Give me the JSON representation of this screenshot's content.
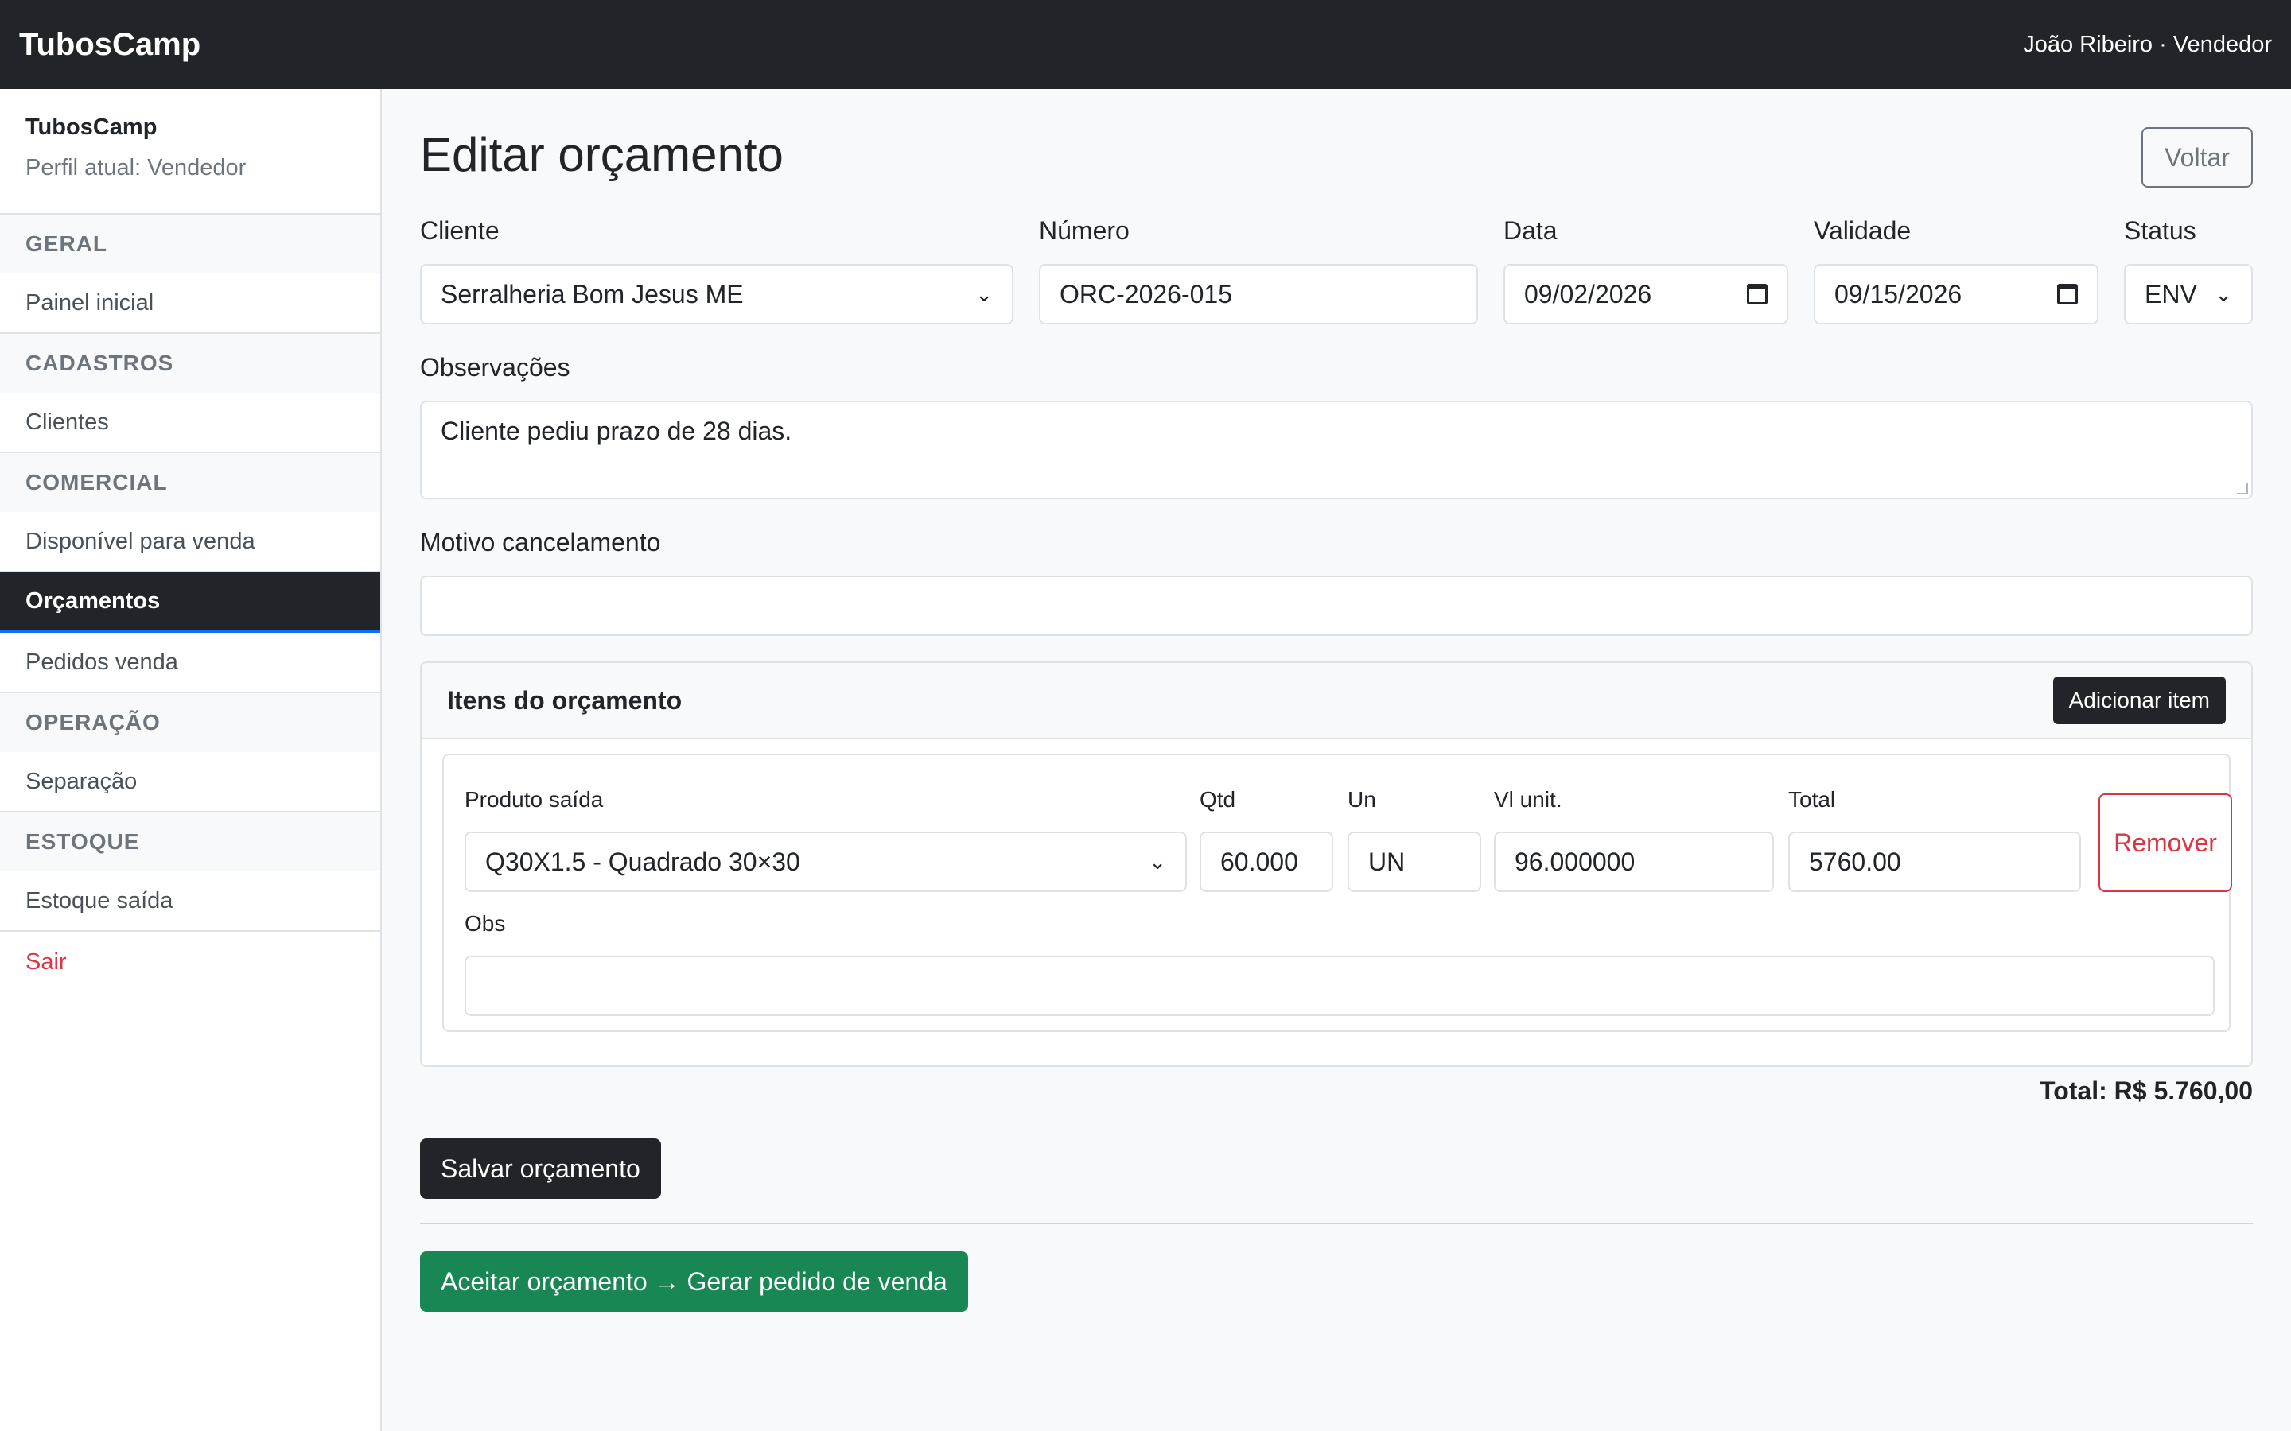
{
  "topbar": {
    "brand": "TubosCamp",
    "user": "João Ribeiro · Vendedor"
  },
  "sidebar": {
    "title": "TubosCamp",
    "profile": "Perfil atual: Vendedor",
    "sections": [
      {
        "label": "GERAL",
        "items": [
          "Painel inicial"
        ]
      },
      {
        "label": "CADASTROS",
        "items": [
          "Clientes"
        ]
      },
      {
        "label": "COMERCIAL",
        "items": [
          "Disponível para venda",
          "Orçamentos",
          "Pedidos venda"
        ]
      },
      {
        "label": "OPERAÇÃO",
        "items": [
          "Separação"
        ]
      },
      {
        "label": "ESTOQUE",
        "items": [
          "Estoque saída"
        ]
      }
    ],
    "active_item": "Orçamentos",
    "logout": "Sair"
  },
  "page": {
    "title": "Editar orçamento",
    "back_label": "Voltar"
  },
  "form": {
    "cliente_label": "Cliente",
    "cliente_value": "Serralheria Bom Jesus ME",
    "numero_label": "Número",
    "numero_value": "ORC-2026-015",
    "data_label": "Data",
    "data_value": "09/02/2026",
    "validade_label": "Validade",
    "validade_value": "09/15/2026",
    "status_label": "Status",
    "status_value": "ENV",
    "obs_label": "Observações",
    "obs_value": "Cliente pediu prazo de 28 dias.",
    "motivo_label": "Motivo cancelamento",
    "motivo_value": ""
  },
  "items_card": {
    "title": "Itens do orçamento",
    "add_label": "Adicionar item",
    "item": {
      "produto_label": "Produto saída",
      "produto_value": "Q30X1.5 - Quadrado 30×30",
      "qtd_label": "Qtd",
      "qtd_value": "60.000",
      "un_label": "Un",
      "un_value": "UN",
      "vl_label": "Vl unit.",
      "vl_value": "96.000000",
      "total_label": "Total",
      "total_value": "5760.00",
      "remove_label": "Remover",
      "obs_label": "Obs",
      "obs_value": ""
    }
  },
  "summary": {
    "total": "Total: R$ 5.760,00"
  },
  "actions": {
    "save_label": "Salvar orçamento",
    "accept_label": "Aceitar orçamento → Gerar pedido de venda"
  }
}
